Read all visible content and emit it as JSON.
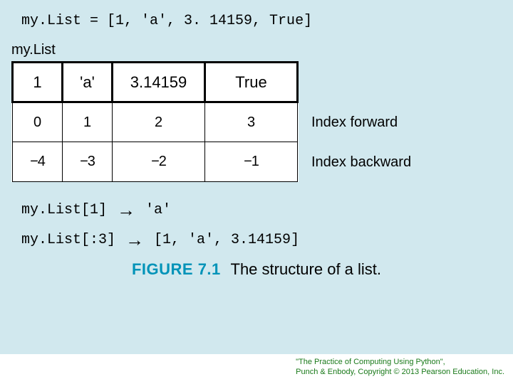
{
  "code_declaration": "my.List = [1, 'a', 3. 14159, True]",
  "var_label": "my.List",
  "table": {
    "columns": 4,
    "values": [
      "1",
      "'a'",
      "3.14159",
      "True"
    ],
    "index_forward": [
      "0",
      "1",
      "2",
      "3"
    ],
    "index_backward": [
      "−4",
      "−3",
      "−2",
      "−1"
    ],
    "forward_label": "Index forward",
    "backward_label": "Index backward"
  },
  "examples": [
    {
      "expr": "my.List[1]",
      "result": "'a'"
    },
    {
      "expr": "my.List[:3]",
      "result": "[1, 'a', 3.14159]"
    }
  ],
  "caption": {
    "label": "FIGURE 7.1",
    "text": "The structure of a list."
  },
  "credit": {
    "line1": "\"The Practice of Computing Using Python\",",
    "line2": "Punch & Enbody, Copyright © 2013 Pearson Education, Inc."
  }
}
